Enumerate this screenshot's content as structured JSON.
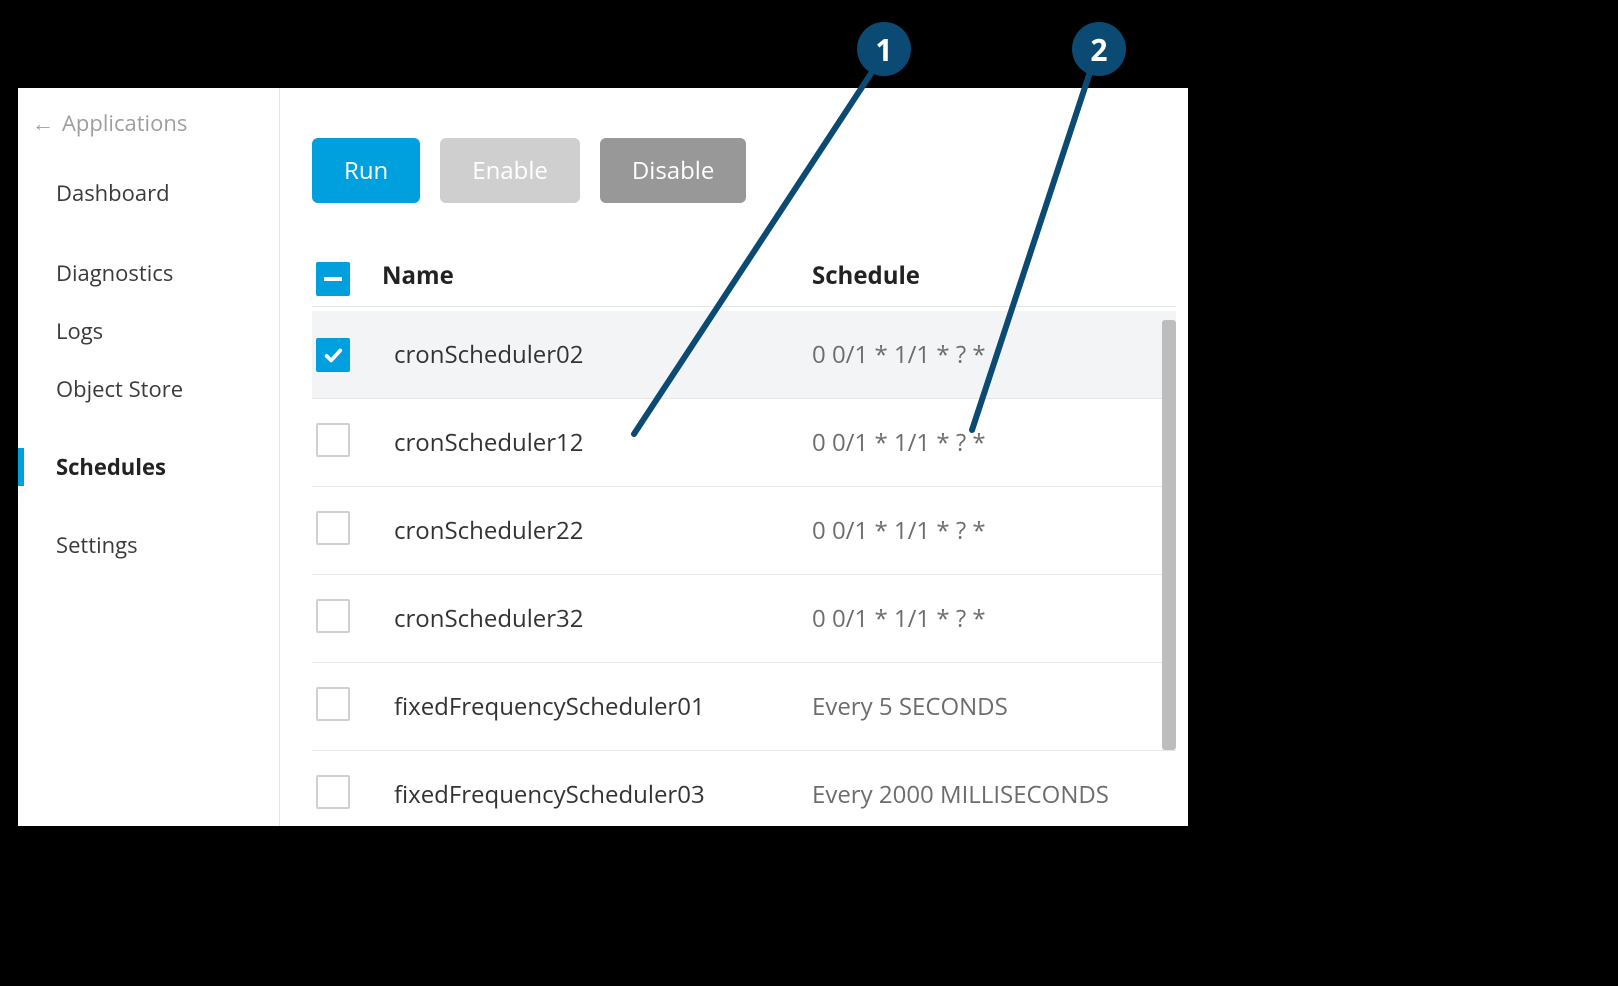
{
  "callouts": {
    "one": "1",
    "two": "2"
  },
  "sidebar": {
    "back_label": "Applications",
    "items": [
      {
        "label": "Dashboard"
      },
      {
        "label": "Diagnostics"
      },
      {
        "label": "Logs"
      },
      {
        "label": "Object Store"
      },
      {
        "label": "Schedules"
      },
      {
        "label": "Settings"
      }
    ]
  },
  "toolbar": {
    "run_label": "Run",
    "enable_label": "Enable",
    "disable_label": "Disable"
  },
  "table": {
    "headers": {
      "name": "Name",
      "schedule": "Schedule"
    },
    "rows": [
      {
        "name": "cronScheduler02",
        "schedule": "0 0/1 * 1/1 * ? *",
        "checked": true
      },
      {
        "name": "cronScheduler12",
        "schedule": "0 0/1 * 1/1 * ? *",
        "checked": false
      },
      {
        "name": "cronScheduler22",
        "schedule": "0 0/1 * 1/1 * ? *",
        "checked": false
      },
      {
        "name": "cronScheduler32",
        "schedule": "0 0/1 * 1/1 * ? *",
        "checked": false
      },
      {
        "name": "fixedFrequencyScheduler01",
        "schedule": "Every 5 SECONDS",
        "checked": false
      },
      {
        "name": "fixedFrequencyScheduler03",
        "schedule": "Every 2000 MILLISECONDS",
        "checked": false
      }
    ]
  },
  "colors": {
    "accent": "#00a0df",
    "callout": "#0b4a72"
  }
}
